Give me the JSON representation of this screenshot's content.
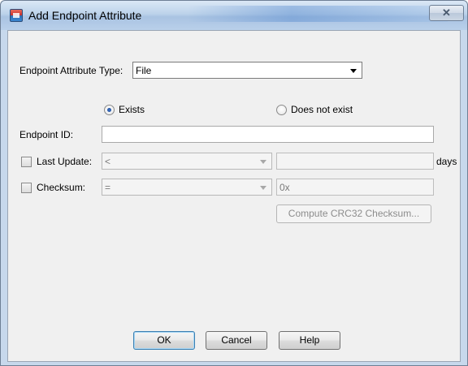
{
  "window": {
    "title": "Add Endpoint Attribute",
    "close_glyph": "✕"
  },
  "form": {
    "type_label": "Endpoint Attribute Type:",
    "type_value": "File",
    "exists_label": "Exists",
    "not_exists_label": "Does not exist",
    "exists_selected": true,
    "endpoint_id_label": "Endpoint ID:",
    "endpoint_id_value": "",
    "last_update_label": "Last Update:",
    "last_update_operator": "<",
    "last_update_value": "",
    "days_label": "days",
    "checksum_label": "Checksum:",
    "checksum_operator": "=",
    "checksum_value": "0x",
    "compute_button": "Compute CRC32 Checksum..."
  },
  "buttons": {
    "ok": "OK",
    "cancel": "Cancel",
    "help": "Help"
  },
  "icons": {
    "app": "endpoint-app-icon",
    "close": "close-icon",
    "dropdown": "chevron-down-icon"
  }
}
